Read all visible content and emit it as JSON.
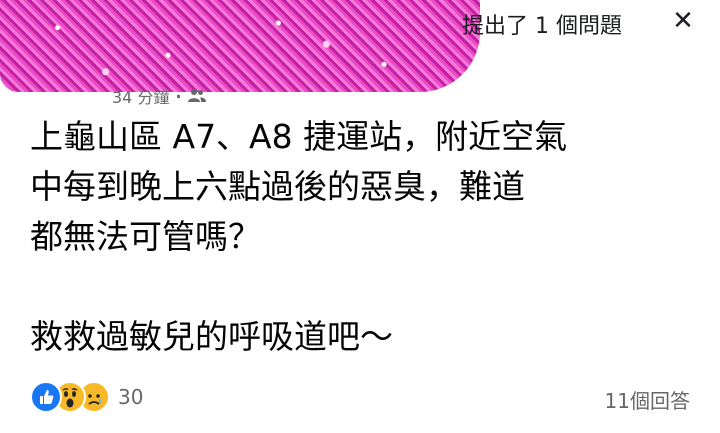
{
  "header": {
    "title": "提出了 1 個問題",
    "close_label": "✕",
    "timestamp": "34 分鐘",
    "separator": "·",
    "audience_icon": "friends-icon"
  },
  "post": {
    "lines": [
      "上龜山區 A7、A8 捷運站，附近空氣",
      "中每到晚上六點過後的惡臭，難道",
      "都無法可管嗎？"
    ],
    "closing_line": "救救過敏兒的呼吸道吧～"
  },
  "footer": {
    "reaction_icons": [
      "like-icon",
      "wow-icon",
      "sad-icon"
    ],
    "reaction_count": "30",
    "comment_count": "11個回答"
  },
  "colors": {
    "like": "#1877f2",
    "emoji": "#f7b928",
    "secondary_text": "#65676b"
  }
}
